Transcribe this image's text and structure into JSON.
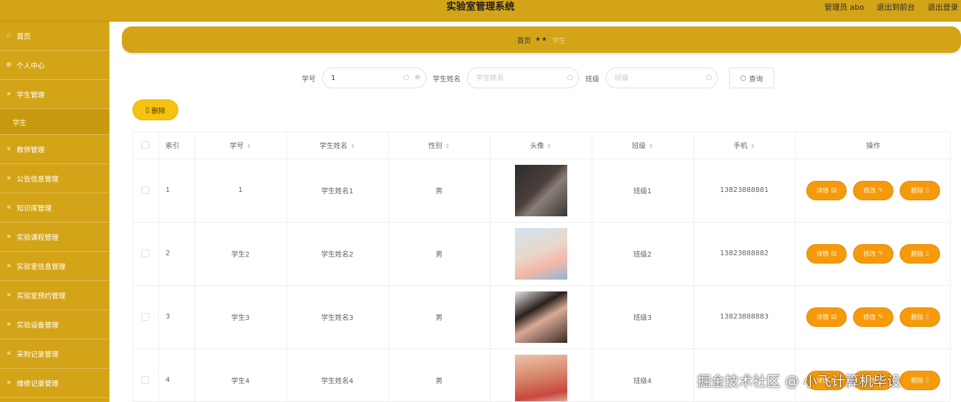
{
  "app": {
    "title": "实验室管理系统",
    "admin_label": "管理员 abo",
    "front_link": "退出到前台",
    "logout_link": "退出登录"
  },
  "sidebar": {
    "items": [
      {
        "label": "首页",
        "icon": "home-icon"
      },
      {
        "label": "个人中心",
        "icon": "user-icon"
      },
      {
        "label": "学生管理",
        "icon": "folder-icon"
      },
      {
        "label": "学生",
        "icon": "",
        "sub": true
      },
      {
        "label": "教师管理",
        "icon": "folder-icon"
      },
      {
        "label": "公告信息管理",
        "icon": "folder-icon"
      },
      {
        "label": "知识库管理",
        "icon": "folder-icon"
      },
      {
        "label": "实验课程管理",
        "icon": "folder-icon"
      },
      {
        "label": "实验室信息管理",
        "icon": "folder-icon"
      },
      {
        "label": "实验室预约管理",
        "icon": "folder-icon"
      },
      {
        "label": "实验设备管理",
        "icon": "folder-icon"
      },
      {
        "label": "采购记录管理",
        "icon": "folder-icon"
      },
      {
        "label": "维修记录管理",
        "icon": "folder-icon"
      }
    ]
  },
  "breadcrumb": {
    "home": "首页",
    "separator": "★★",
    "current": "学生"
  },
  "search": {
    "student_no_label": "学号",
    "student_no_value": "1",
    "student_name_label": "学生姓名",
    "student_name_placeholder": "学生姓名",
    "class_label": "班级",
    "class_placeholder": "班级",
    "query_button": "查询"
  },
  "actions": {
    "delete_button": "删除"
  },
  "table": {
    "headers": {
      "index": "索引",
      "student_no": "学号",
      "student_name": "学生姓名",
      "gender": "性别",
      "avatar": "头像",
      "class": "班级",
      "phone": "手机",
      "operation": "操作"
    },
    "rows": [
      {
        "index": "1",
        "student_no": "1",
        "student_name": "学生姓名1",
        "gender": "男",
        "class": "班级1",
        "phone": "13823888881"
      },
      {
        "index": "2",
        "student_no": "学生2",
        "student_name": "学生姓名2",
        "gender": "男",
        "class": "班级2",
        "phone": "13823888882"
      },
      {
        "index": "3",
        "student_no": "学生3",
        "student_name": "学生姓名3",
        "gender": "男",
        "class": "班级3",
        "phone": "13823888883"
      },
      {
        "index": "4",
        "student_no": "学生4",
        "student_name": "学生姓名4",
        "gender": "男",
        "class": "班级4",
        "phone": ""
      }
    ],
    "row_buttons": {
      "detail": "详情",
      "edit": "修改",
      "delete": "删除"
    }
  },
  "watermark": "掘金技术社区 @ 小飞计算机毕设",
  "colors": {
    "theme": "#d4a418",
    "button_orange": "#f59a0c",
    "delete_yellow": "#f5c20f"
  }
}
